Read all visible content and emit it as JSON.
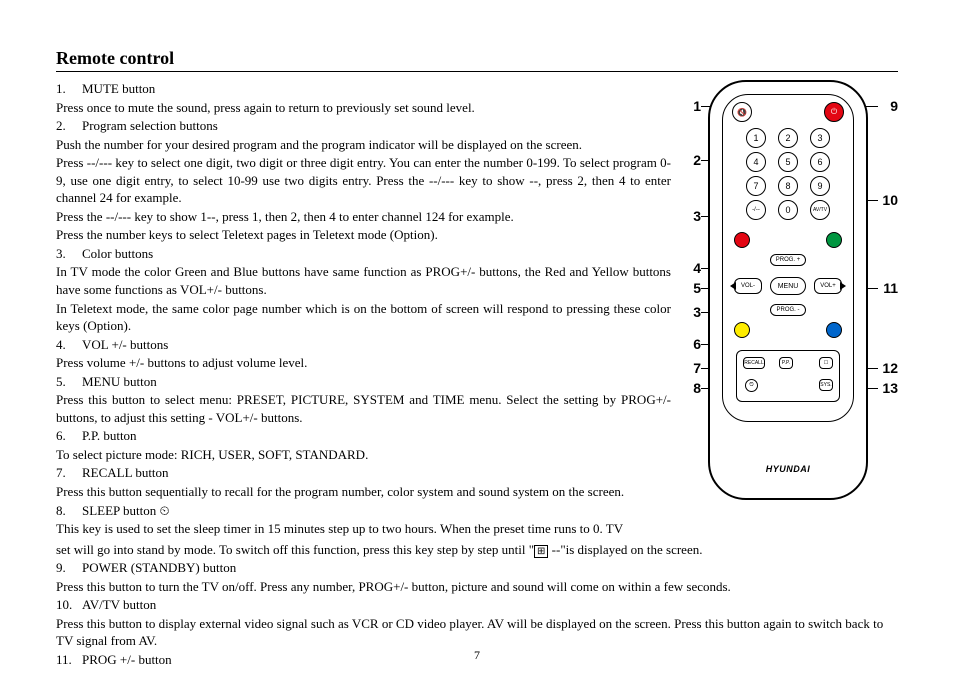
{
  "title": "Remote control",
  "page_number": "7",
  "items": [
    {
      "num": "1.",
      "label": "MUTE button"
    },
    {
      "num": "2.",
      "label": "Program selection buttons"
    },
    {
      "num": "3.",
      "label": "Color buttons"
    },
    {
      "num": "4.",
      "label": "VOL +/- buttons"
    },
    {
      "num": "5.",
      "label": "MENU button"
    },
    {
      "num": "6.",
      "label": "P.P. button"
    },
    {
      "num": "7.",
      "label": "RECALL button"
    },
    {
      "num": "8.",
      "label": "SLEEP button"
    },
    {
      "num": "9.",
      "label": "POWER (STANDBY) button"
    },
    {
      "num": "10.",
      "label": "AV/TV button"
    },
    {
      "num": "11.",
      "label": "PROG +/- button"
    }
  ],
  "para": {
    "p1": "Press once to mute the sound, press again to return to previously set sound level.",
    "p2a": "Push the number for your desired program and the program indicator will be displayed on the screen.",
    "p2b": "Press --/--- key to select one digit, two digit or three digit entry. You can enter the number 0-199. To select program 0-9, use one digit entry, to select 10-99 use two digits entry. Press the --/--- key to show --, press 2, then 4 to enter channel 24 for example.",
    "p2c": "Press the --/--- key to show 1--, press 1, then 2, then 4 to enter channel 124 for example.",
    "p2d": "Press the number keys to select Teletext pages in Teletext mode (Option).",
    "p3a": "In TV mode the color Green and Blue buttons have same function as PROG+/- buttons, the Red and Yellow buttons have some functions as VOL+/- buttons.",
    "p3b": "In Teletext mode, the same color page number which is on the bottom of screen will respond to pressing these color keys (Option).",
    "p4": "Press volume +/- buttons to adjust volume level.",
    "p5": "Press this button to select menu: PRESET, PICTURE, SYSTEM and TIME menu. Select the setting by PROG+/- buttons, to adjust this setting - VOL+/- buttons.",
    "p6": "To select picture mode: RICH, USER, SOFT, STANDARD.",
    "p7": "Press this button sequentially to recall for the program number, color system and sound system on the screen.",
    "p8a": "This key is used to set the sleep timer in 15 minutes step up to two hours. When the preset time runs to 0. TV",
    "p8b_pre": "set will go into stand by mode. To switch off this function, press this key step by step until \"",
    "p8b_post": " --\"is displayed on the screen.",
    "p9": "Press this button to turn the TV on/off. Press any number, PROG+/- button, picture and sound will come on within a few seconds.",
    "p10": "Press this button to display external video signal such as VCR or CD video player. AV will be displayed on the screen. Press this button again to switch back to TV signal from AV."
  },
  "remote": {
    "brand": "HYUNDAI",
    "numbers": [
      "1",
      "2",
      "3",
      "4",
      "5",
      "6",
      "7",
      "8",
      "9",
      "0"
    ],
    "mute": "⊘",
    "digits_extra": "-/--",
    "avtv": "AV/TV",
    "menu": "MENU",
    "prog_plus": "PROG. +",
    "prog_minus": "PROG. -",
    "vol_minus": "VOL-",
    "vol_plus": "VOL+",
    "recall": "RECALL",
    "pp": "P.P.",
    "sys": "SYS.",
    "sleep": "⏲"
  },
  "callouts_left": [
    "1",
    "2",
    "3",
    "4",
    "5",
    "3",
    "6",
    "7",
    "8"
  ],
  "callouts_right": [
    "9",
    "10",
    "11",
    "12",
    "13"
  ]
}
